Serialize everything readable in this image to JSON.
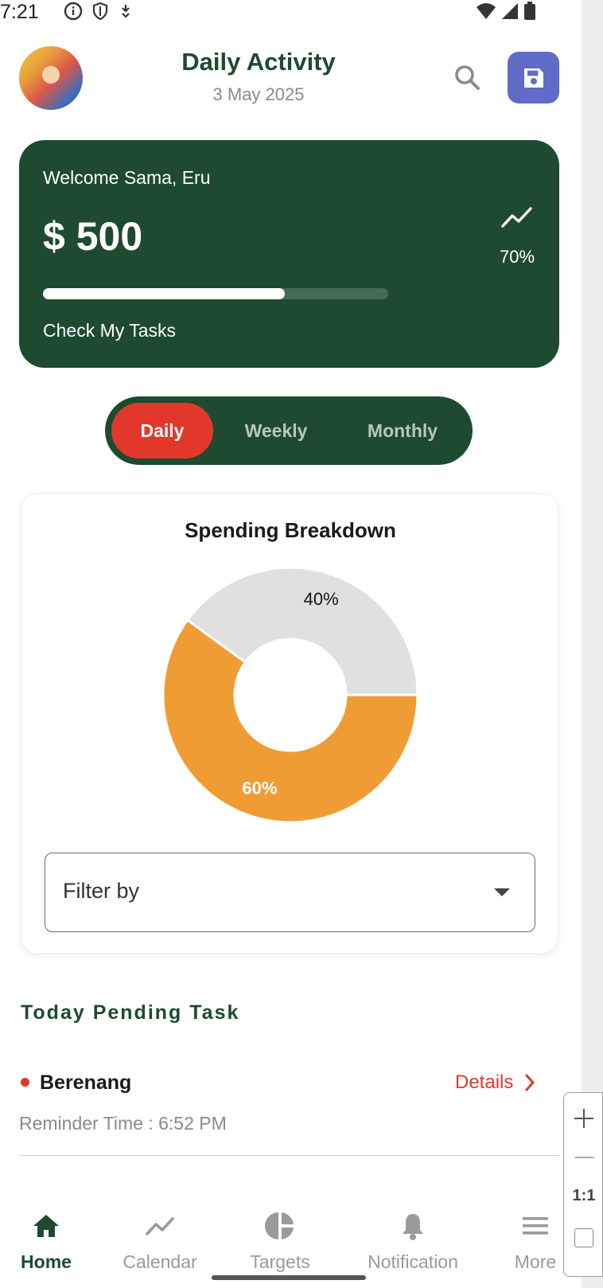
{
  "status_bar": {
    "time": "7:21"
  },
  "header": {
    "title": "Daily Activity",
    "date": "3 May 2025",
    "search_icon": "search-icon",
    "save_icon": "save-icon",
    "save_color": "#5f6bc6"
  },
  "balance_card": {
    "welcome": "Welcome Sama, Eru",
    "amount": "$ 500",
    "trend_percent": "70%",
    "progress_fraction": 0.7,
    "cta": "Check My Tasks",
    "background": "#1e4a30"
  },
  "period_tabs": [
    {
      "label": "Daily",
      "selected": true
    },
    {
      "label": "Weekly",
      "selected": false
    },
    {
      "label": "Monthly",
      "selected": false
    }
  ],
  "spending": {
    "title": "Spending Breakdown",
    "filter_placeholder": "Filter by"
  },
  "chart_data": {
    "type": "pie",
    "title": "Spending Breakdown",
    "donut": true,
    "slices": [
      {
        "label": "40%",
        "value": 40,
        "color": "#e0e0e0"
      },
      {
        "label": "60%",
        "value": 60,
        "color": "#f09c35"
      }
    ]
  },
  "pending": {
    "title": "Today Pending Task",
    "tasks": [
      {
        "name": "Berenang",
        "reminder": "Reminder Time : 6:52 PM",
        "details_label": "Details"
      }
    ]
  },
  "zoom": {
    "ratio": "1:1"
  },
  "nav": [
    {
      "label": "Home",
      "icon": "home-icon",
      "active": true
    },
    {
      "label": "Calendar",
      "icon": "trend-icon",
      "active": false
    },
    {
      "label": "Targets",
      "icon": "pie-chart-icon",
      "active": false
    },
    {
      "label": "Notification",
      "icon": "bell-icon",
      "active": false
    },
    {
      "label": "More",
      "icon": "menu-icon",
      "active": false
    }
  ]
}
